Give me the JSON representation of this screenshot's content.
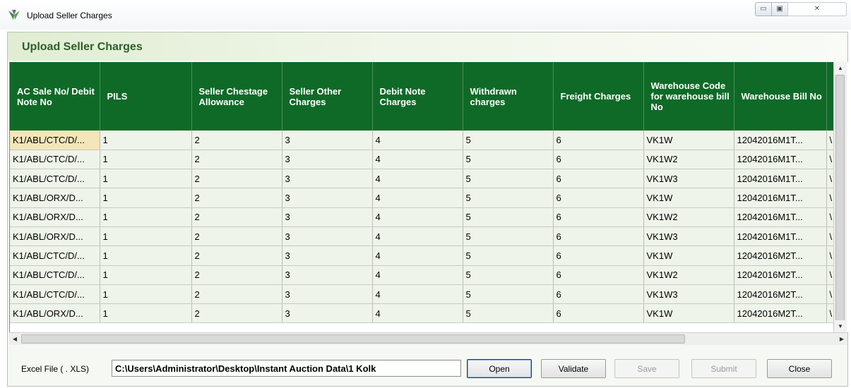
{
  "window": {
    "title": "Upload Seller Charges",
    "controls": {
      "minimize": "▭",
      "maximize": "▣",
      "close": "✕"
    }
  },
  "panel": {
    "title": "Upload Seller Charges"
  },
  "grid": {
    "columns": [
      "AC Sale No/ Debit Note No",
      "PILS",
      "Seller Chestage Allowance",
      "Seller Other Charges",
      "Debit Note Charges",
      "Withdrawn charges",
      "Freight Charges",
      "Warehouse Code for warehouse bill No",
      "Warehouse Bill No",
      ""
    ],
    "rows": [
      [
        "K1/ABL/CTC/D/...",
        "1",
        "2",
        "3",
        "4",
        "5",
        "6",
        "VK1W",
        "12042016M1T...",
        "\\"
      ],
      [
        "K1/ABL/CTC/D/...",
        "1",
        "2",
        "3",
        "4",
        "5",
        "6",
        "VK1W2",
        "12042016M1T...",
        "\\"
      ],
      [
        "K1/ABL/CTC/D/...",
        "1",
        "2",
        "3",
        "4",
        "5",
        "6",
        "VK1W3",
        "12042016M1T...",
        "\\"
      ],
      [
        "K1/ABL/ORX/D...",
        "1",
        "2",
        "3",
        "4",
        "5",
        "6",
        "VK1W",
        "12042016M1T...",
        "\\"
      ],
      [
        "K1/ABL/ORX/D...",
        "1",
        "2",
        "3",
        "4",
        "5",
        "6",
        "VK1W2",
        "12042016M1T...",
        "\\"
      ],
      [
        "K1/ABL/ORX/D...",
        "1",
        "2",
        "3",
        "4",
        "5",
        "6",
        "VK1W3",
        "12042016M1T...",
        "\\"
      ],
      [
        "K1/ABL/CTC/D/...",
        "1",
        "2",
        "3",
        "4",
        "5",
        "6",
        "VK1W",
        "12042016M2T...",
        "\\"
      ],
      [
        "K1/ABL/CTC/D/...",
        "1",
        "2",
        "3",
        "4",
        "5",
        "6",
        "VK1W2",
        "12042016M2T...",
        "\\"
      ],
      [
        "K1/ABL/CTC/D/...",
        "1",
        "2",
        "3",
        "4",
        "5",
        "6",
        "VK1W3",
        "12042016M2T...",
        "\\"
      ],
      [
        "K1/ABL/ORX/D...",
        "1",
        "2",
        "3",
        "4",
        "5",
        "6",
        "VK1W",
        "12042016M2T...",
        "\\"
      ]
    ]
  },
  "footer": {
    "excel_label": "Excel File ( . XLS)",
    "excel_path": "C:\\Users\\Administrator\\Desktop\\Instant Auction Data\\1 Kolk",
    "buttons": {
      "open": "Open",
      "validate": "Validate",
      "save": "Save",
      "submit": "Submit",
      "close": "Close"
    }
  },
  "colors": {
    "header_green": "#0f6a27",
    "title_green": "#2c5e2a",
    "row_bg": "#eef4e9"
  }
}
